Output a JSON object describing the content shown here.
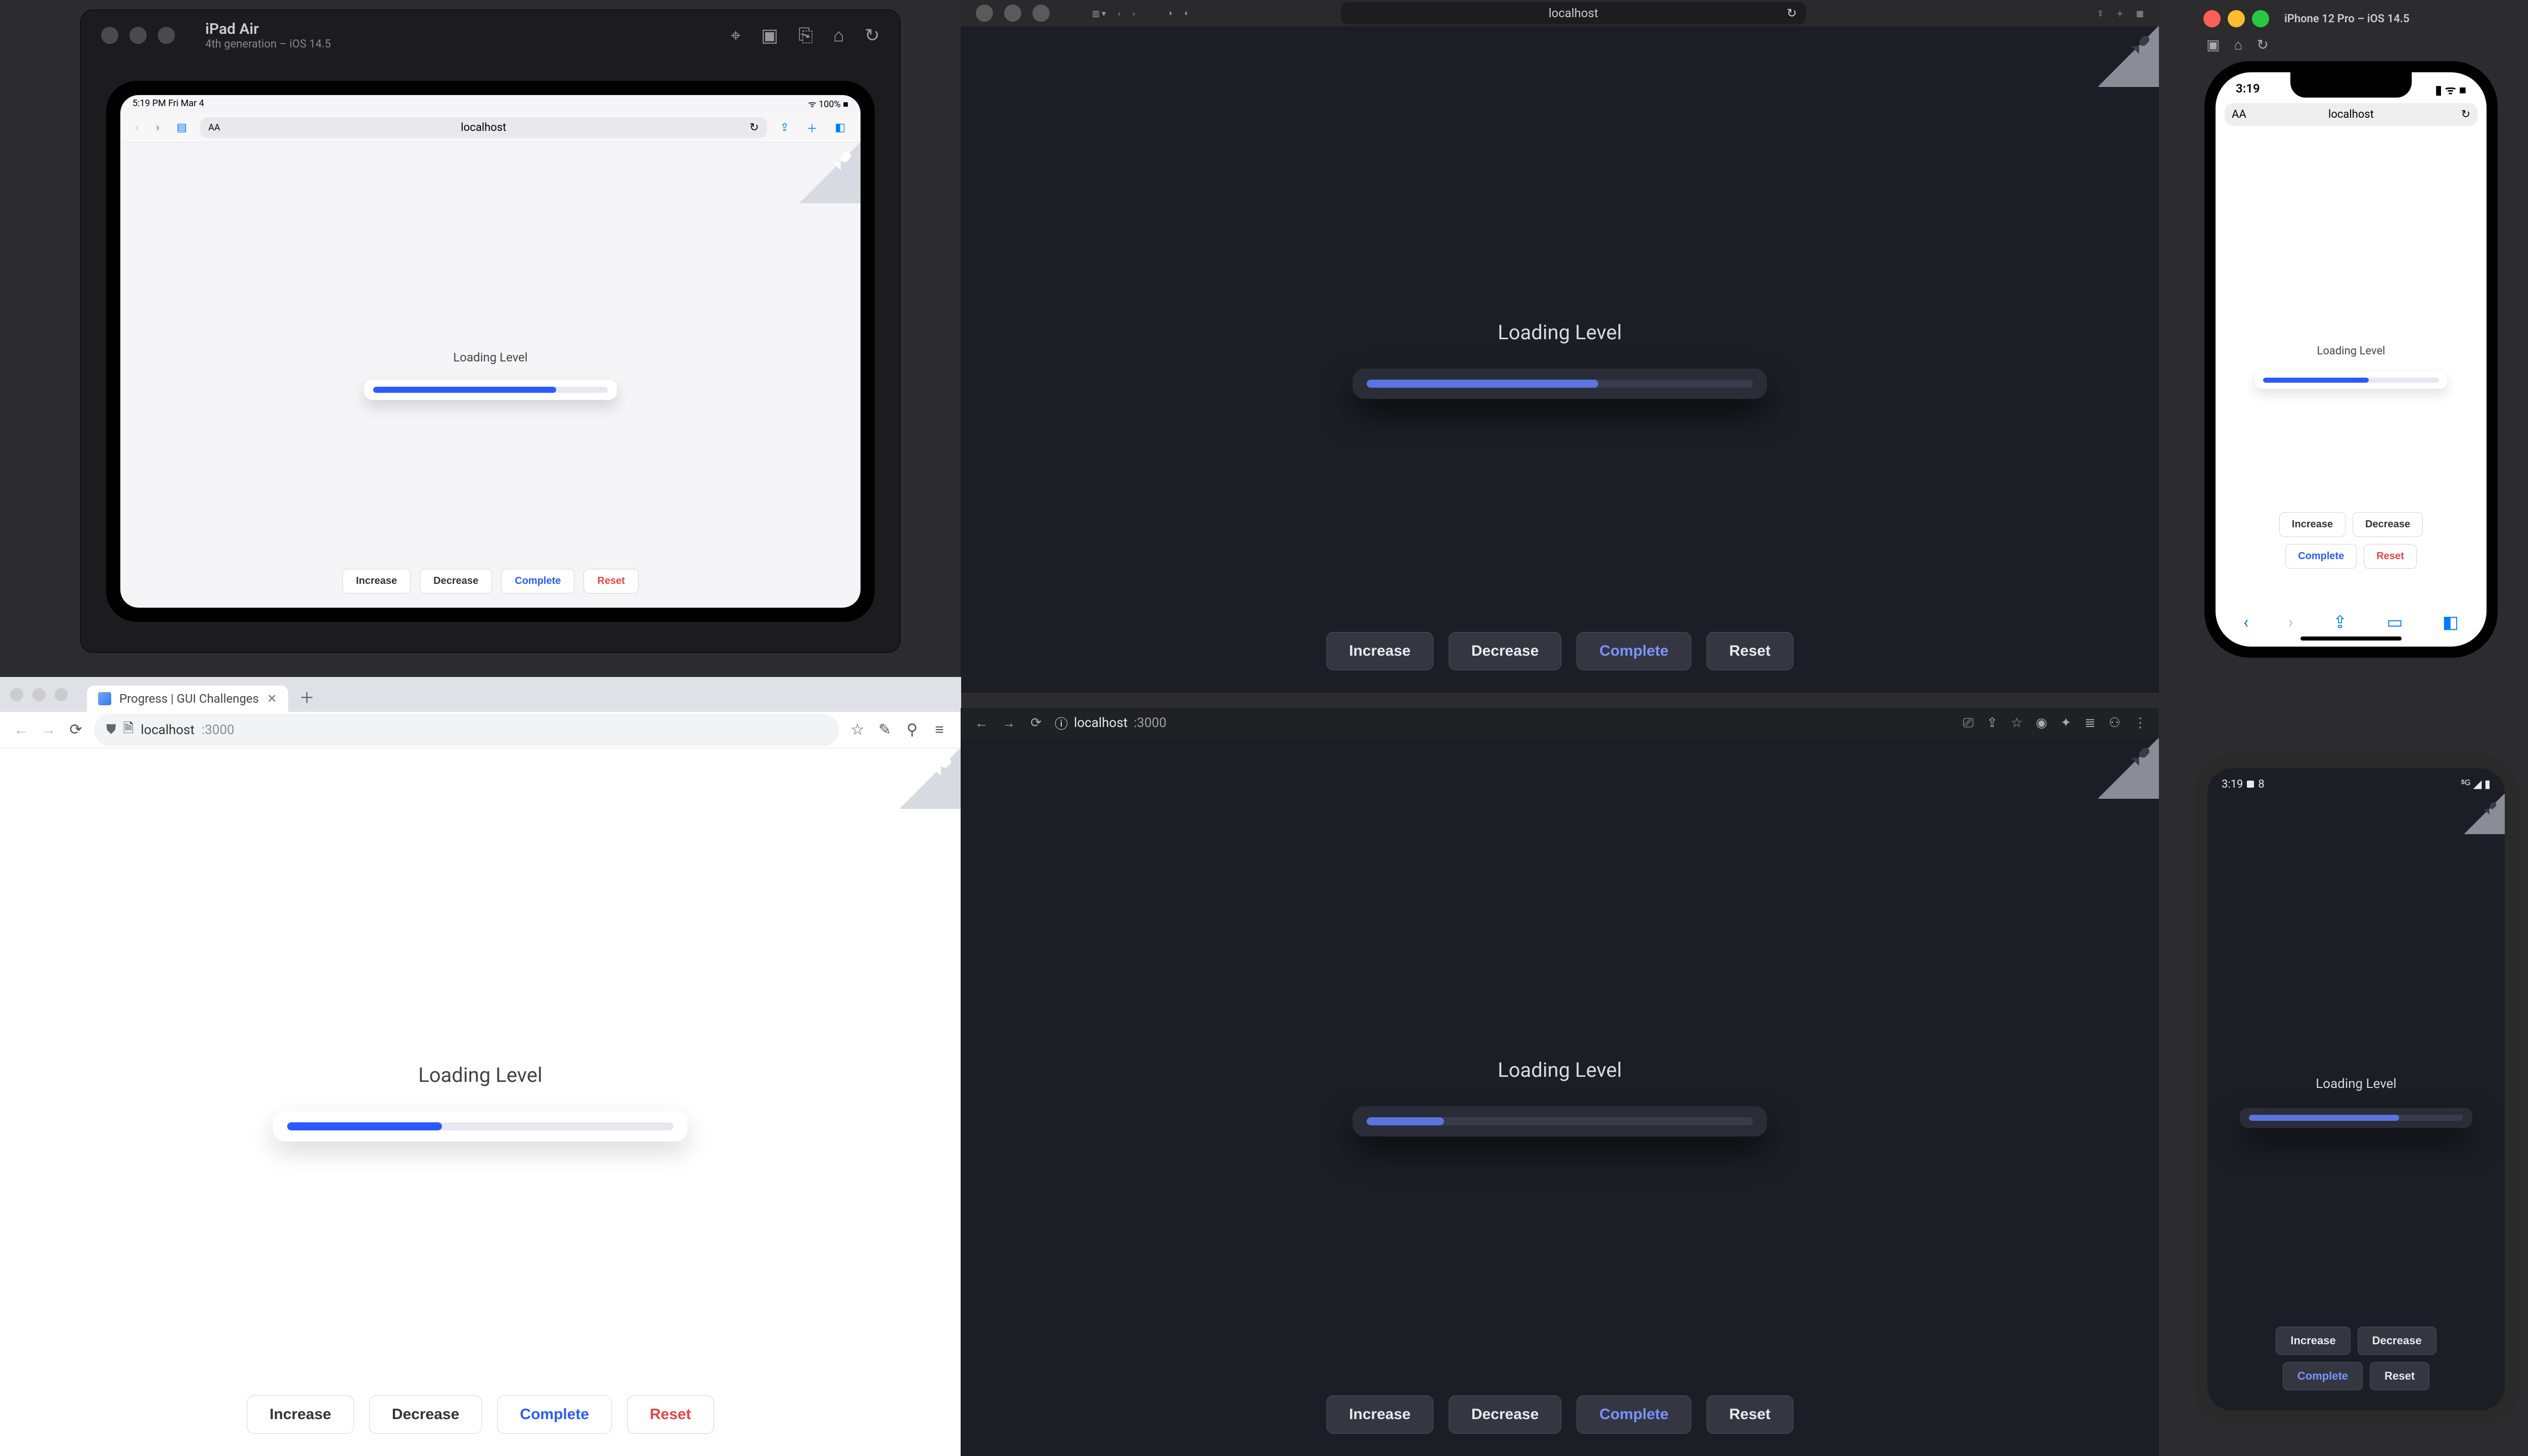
{
  "demo": {
    "heading": "Loading Level",
    "buttons": {
      "increase": "Increase",
      "decrease": "Decrease",
      "complete": "Complete",
      "reset": "Reset"
    }
  },
  "progress": {
    "safari_big_pct": 60,
    "ipad_pct": 78,
    "chrome_light_pct": 40,
    "chrome_dark_pct": 20,
    "iphone_pct": 60,
    "android_pct": 70
  },
  "ipad_sim": {
    "title": "iPad Air",
    "subtitle": "4th generation – iOS 14.5",
    "status_left": "5:19 PM  Fri Mar 4",
    "status_wifi": "100%",
    "url": "localhost"
  },
  "safari_big": {
    "url": "localhost"
  },
  "chrome_light": {
    "tab_title": "Progress | GUI Challenges",
    "url_host": "localhost",
    "url_port": ":3000"
  },
  "chrome_dark": {
    "url_host": "localhost",
    "url_port": ":3000"
  },
  "iphone_sim": {
    "title": "iPhone 12 Pro – iOS 14.5",
    "time": "3:19",
    "url": "localhost"
  },
  "android": {
    "time": "3:19"
  }
}
